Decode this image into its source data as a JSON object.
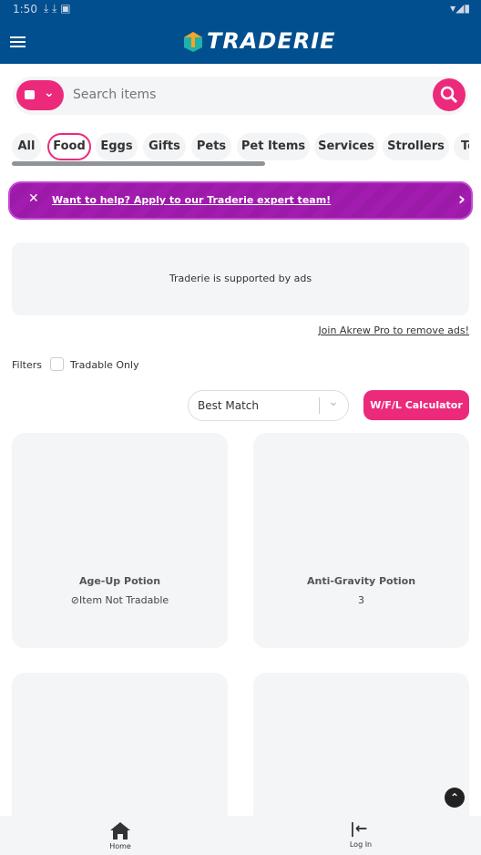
{
  "status_bar": {
    "time": "1:50"
  },
  "header": {
    "logo_text": "TRADERIE"
  },
  "search": {
    "placeholder": "Search items"
  },
  "categories": [
    "All",
    "Food",
    "Eggs",
    "Gifts",
    "Pets",
    "Pet Items",
    "Services",
    "Strollers",
    "Toys"
  ],
  "active_category": "Food",
  "banner": {
    "text": "Want to help? Apply to our Traderie expert team!"
  },
  "ad": {
    "text": "Traderie is supported by ads",
    "remove_link": "Join Akrew Pro to remove ads!"
  },
  "filters": {
    "label": "Filters",
    "tradable_only": "Tradable Only",
    "tradable_checked": false
  },
  "sort": {
    "selected": "Best Match"
  },
  "calculator_label": "W/F/L Calculator",
  "items": [
    {
      "name": "Age-Up Potion",
      "sub": "Item Not Tradable",
      "not_tradable": true
    },
    {
      "name": "Anti-Gravity Potion",
      "sub": "3"
    }
  ],
  "bottom_nav": {
    "home": "Home",
    "login": "Log In"
  },
  "colors": {
    "header": "#014f8f",
    "accent": "#ec2a7b",
    "banner": "#a21caf"
  }
}
